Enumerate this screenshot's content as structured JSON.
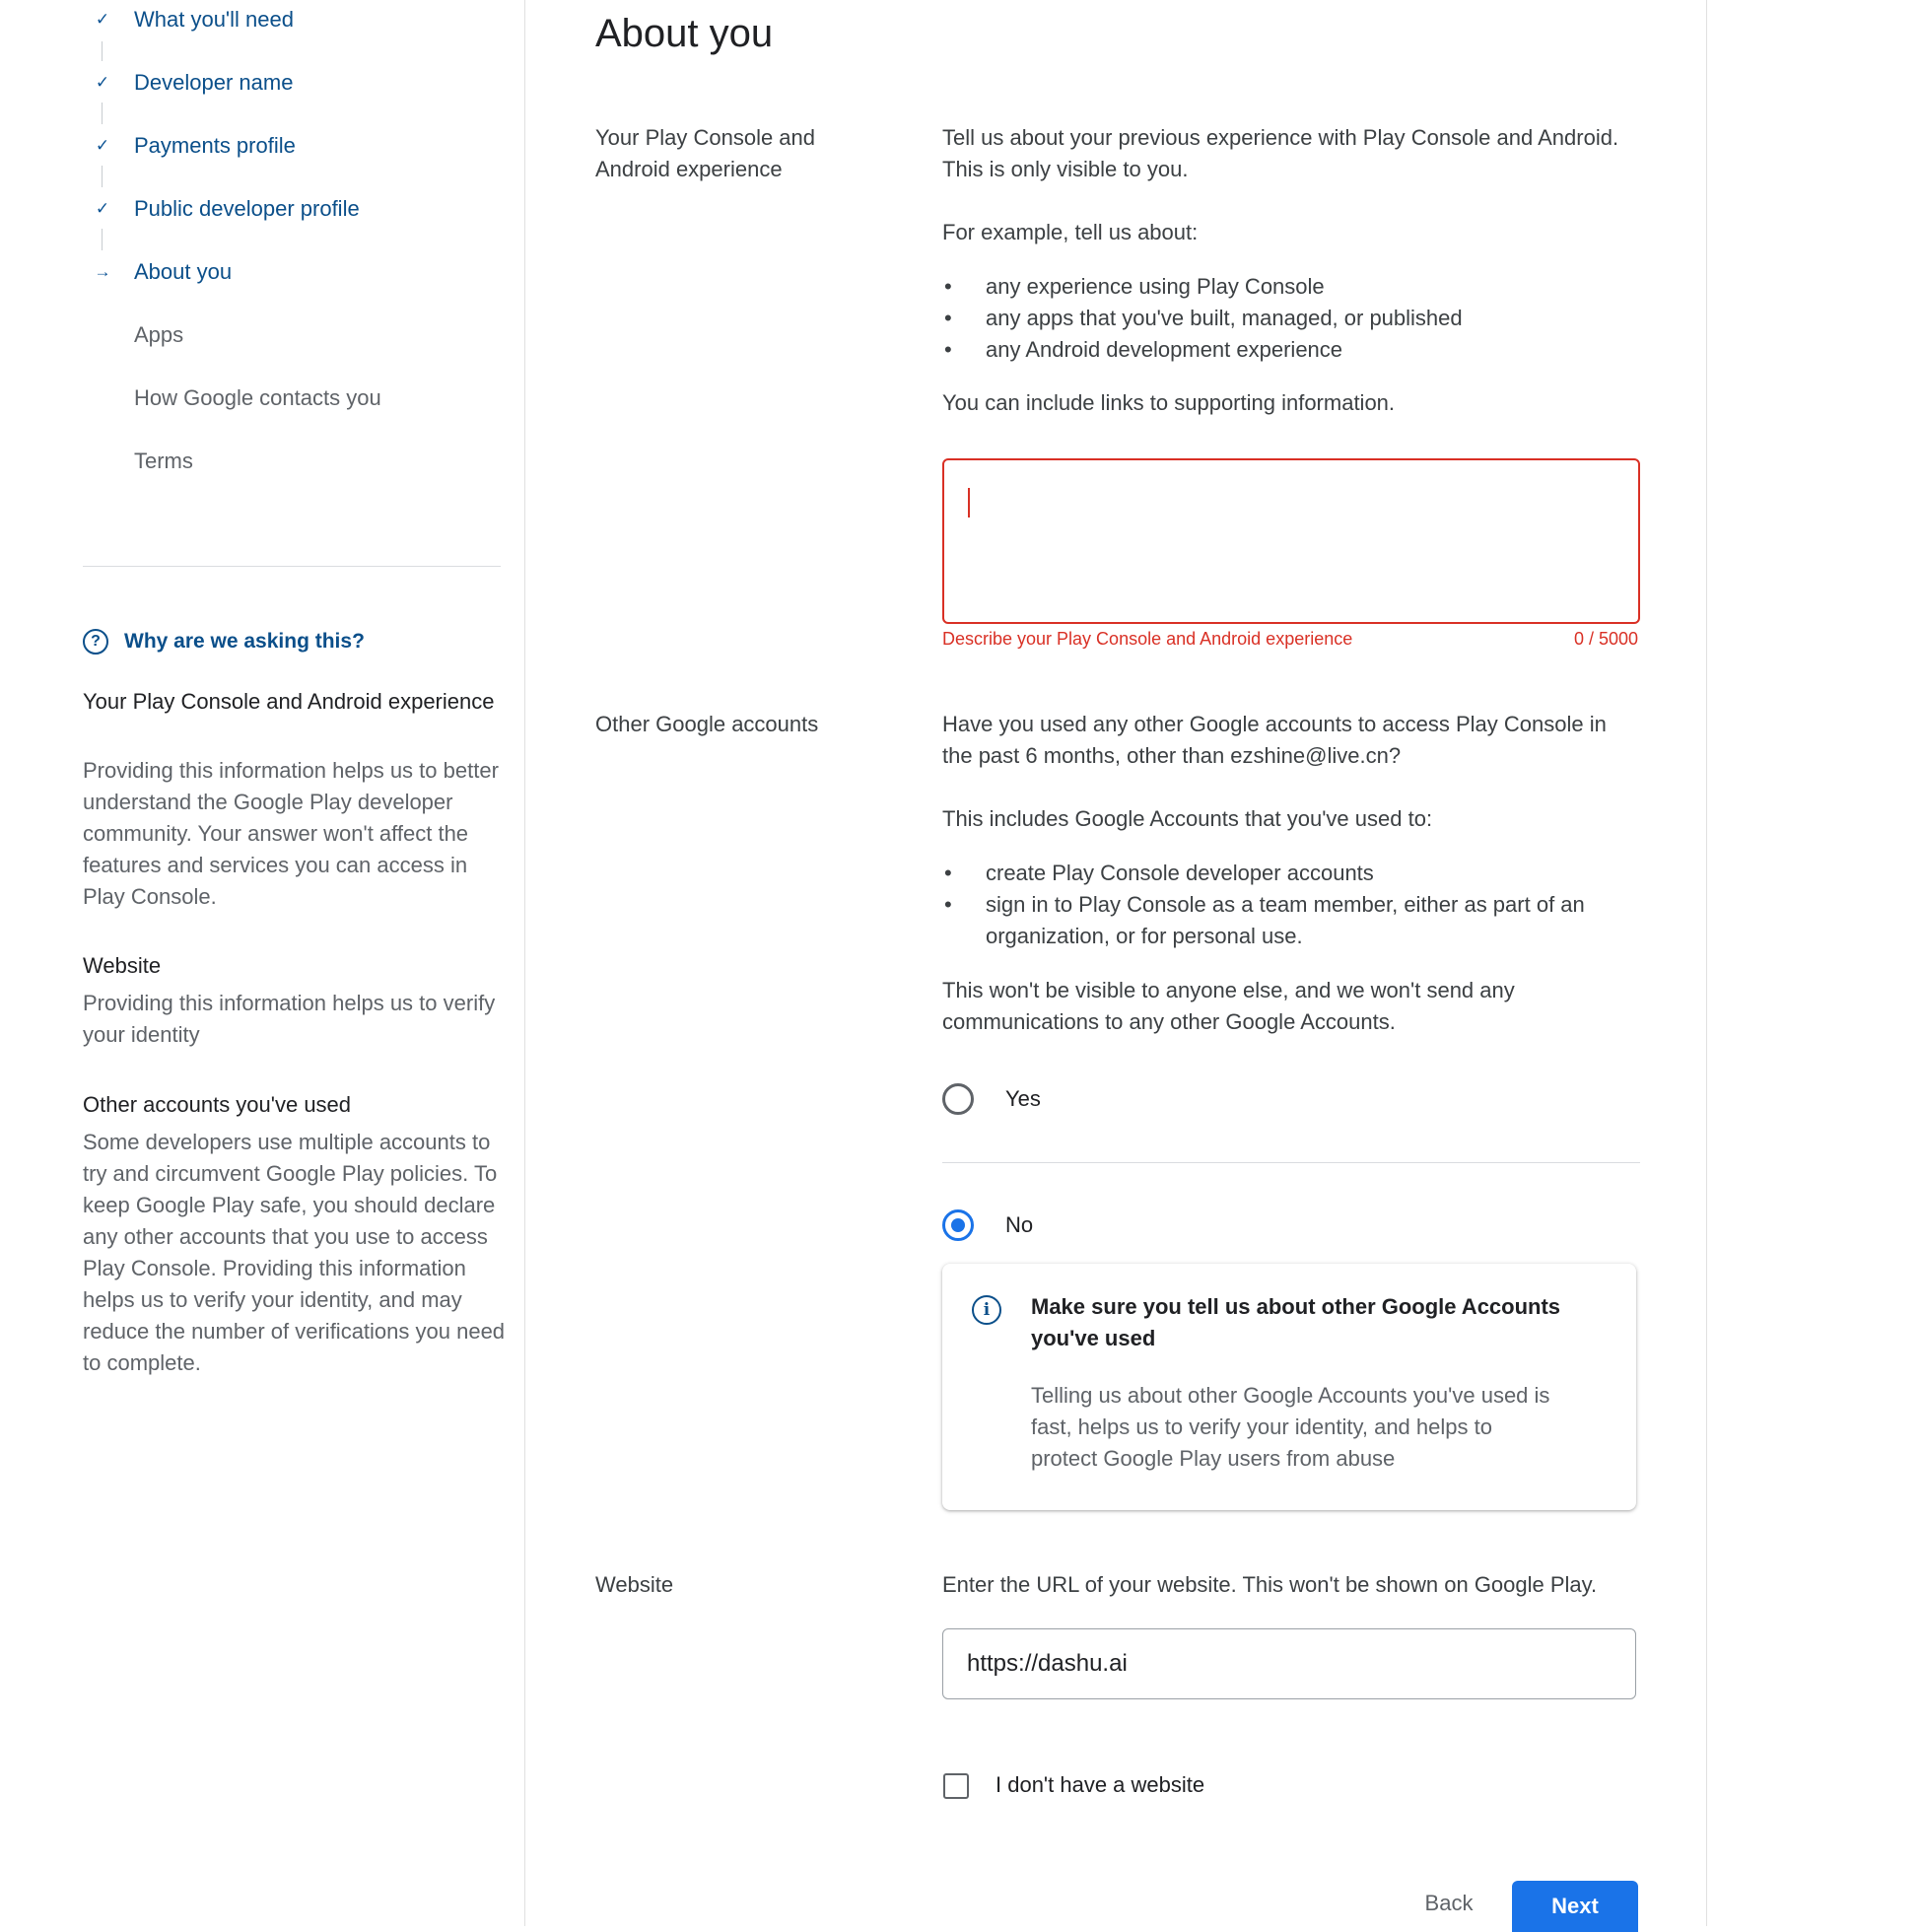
{
  "sidebar": {
    "steps": [
      {
        "label": "What you'll need",
        "mark": "✓",
        "state": "done"
      },
      {
        "label": "Developer name",
        "mark": "✓",
        "state": "done"
      },
      {
        "label": "Payments profile",
        "mark": "✓",
        "state": "done"
      },
      {
        "label": "Public developer profile",
        "mark": "✓",
        "state": "done"
      },
      {
        "label": "About you",
        "mark": "→",
        "state": "current"
      },
      {
        "label": "Apps",
        "mark": "",
        "state": "todo"
      },
      {
        "label": "How Google contacts you",
        "mark": "",
        "state": "todo"
      },
      {
        "label": "Terms",
        "mark": "",
        "state": "todo"
      }
    ],
    "why": {
      "icon": "help-circle-icon",
      "title": "Why are we asking this?",
      "items": [
        {
          "heading": "Your Play Console and Android experience",
          "body": "Providing this information helps us to better understand the Google Play developer community. Your answer won't affect the features and services you can access in Play Console."
        },
        {
          "heading": "Website",
          "body": "Providing this information helps us to verify your identity"
        },
        {
          "heading": "Other accounts you've used",
          "body": "Some developers use multiple accounts to try and circumvent Google Play policies. To keep Google Play safe, you should declare any other accounts that you use to access Play Console. Providing this information helps us to verify your identity, and may reduce the number of verifications you need to complete."
        }
      ]
    }
  },
  "main": {
    "title": "About you",
    "experience": {
      "label": "Your Play Console and Android experience",
      "intro": "Tell us about your previous experience with Play Console and Android. This is only visible to you.",
      "example_lead": "For example, tell us about:",
      "bullets": [
        "any experience using Play Console",
        "any apps that you've built, managed, or published",
        "any Android development experience"
      ],
      "links_note": "You can include links to supporting information.",
      "input_value": "",
      "error": "Describe your Play Console and Android experience",
      "counter": "0 / 5000"
    },
    "accounts": {
      "label": "Other Google accounts",
      "question": "Have you used any other Google accounts to access Play Console in the past 6 months, other than ezshine@live.cn?",
      "includes_lead": "This includes Google Accounts that you've used to:",
      "bullets": [
        "create Play Console developer accounts",
        "sign in to Play Console as a team member, either as part of an organization, or for personal use."
      ],
      "privacy_note": "This won't be visible to anyone else, and we won't send any communications to any other Google Accounts.",
      "options": [
        {
          "label": "Yes",
          "selected": false
        },
        {
          "label": "No",
          "selected": true
        }
      ],
      "info": {
        "icon": "info-icon",
        "title": "Make sure you tell us about other Google Accounts you've used",
        "body": "Telling us about other Google Accounts you've used is fast, helps us to verify your identity, and helps to protect Google Play users from abuse"
      }
    },
    "website": {
      "label": "Website",
      "instruction": "Enter the URL of your website. This won't be shown on Google Play.",
      "url_value": "https://dashu.ai",
      "no_website_label": "I don't have a website",
      "no_website_checked": false
    },
    "actions": {
      "back_label": "Back",
      "next_label": "Next"
    }
  },
  "colors": {
    "accent": "#1a73e8",
    "nav_link": "#0b4f8a",
    "error": "#d93025"
  }
}
